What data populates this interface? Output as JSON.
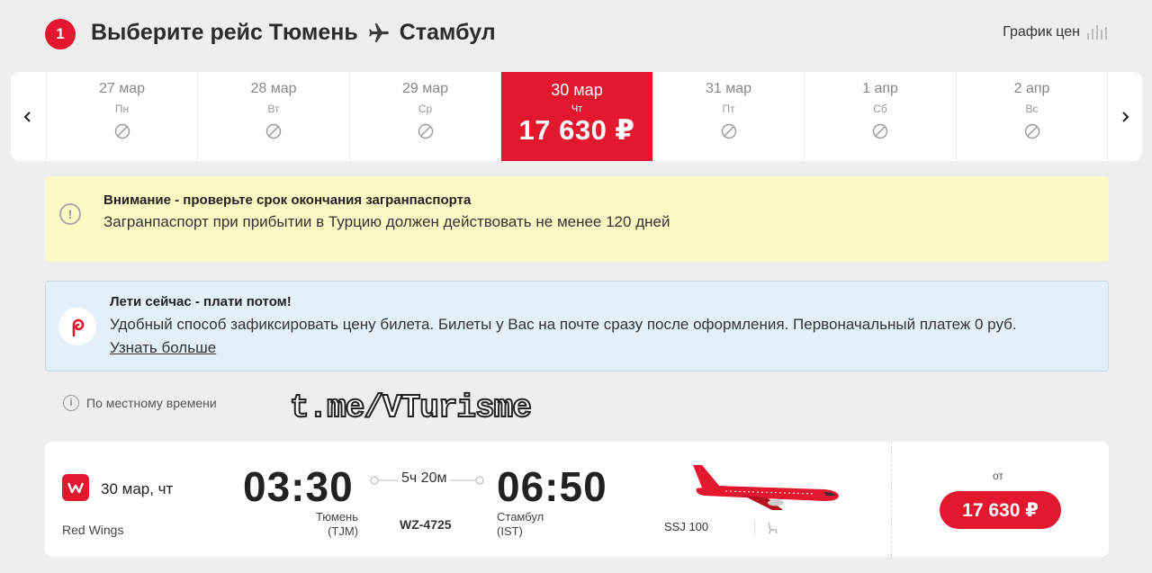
{
  "header": {
    "step": "1",
    "title_prefix": "Выберите рейс Тюмень",
    "title_suffix": "Стамбул",
    "price_graph_label": "График цен"
  },
  "dates": [
    {
      "date": "27 мар",
      "weekday": "Пн",
      "available": false
    },
    {
      "date": "28 мар",
      "weekday": "Вт",
      "available": false
    },
    {
      "date": "29 мар",
      "weekday": "Ср",
      "available": false
    },
    {
      "date": "30 мар",
      "weekday": "Чт",
      "available": true,
      "price": "17 630 ₽",
      "selected": true
    },
    {
      "date": "31 мар",
      "weekday": "Пт",
      "available": false
    },
    {
      "date": "1 апр",
      "weekday": "Сб",
      "available": false
    },
    {
      "date": "2 апр",
      "weekday": "Вс",
      "available": false
    }
  ],
  "warning": {
    "heading": "Внимание - проверьте срок окончания загранпаспорта",
    "text": "Загранпаспорт при прибытии в Турцию должен действовать не менее 120 дней"
  },
  "promo": {
    "heading": "Лети сейчас - плати потом!",
    "text": "Удобный способ зафиксировать цену билета. Билеты у Вас на почте сразу после оформления. Первоначальный платеж 0 руб.",
    "link": "Узнать больше"
  },
  "timezone_note": "По местному времени",
  "watermark": "t.me/VTurisme",
  "flight": {
    "date": "30 мар, чт",
    "airline": "Red Wings",
    "dep_time": "03:30",
    "dep_city": "Тюмень",
    "dep_code": "(TJM)",
    "duration": "5ч 20м",
    "flight_no": "WZ-4725",
    "arr_time": "06:50",
    "arr_city": "Стамбул",
    "arr_code": "(IST)",
    "aircraft": "SSJ 100",
    "from_label": "от",
    "price": "17 630 ₽"
  },
  "colors": {
    "accent": "#e3172d",
    "warning_bg": "#fbf9c4",
    "promo_bg": "#e3eff9"
  }
}
